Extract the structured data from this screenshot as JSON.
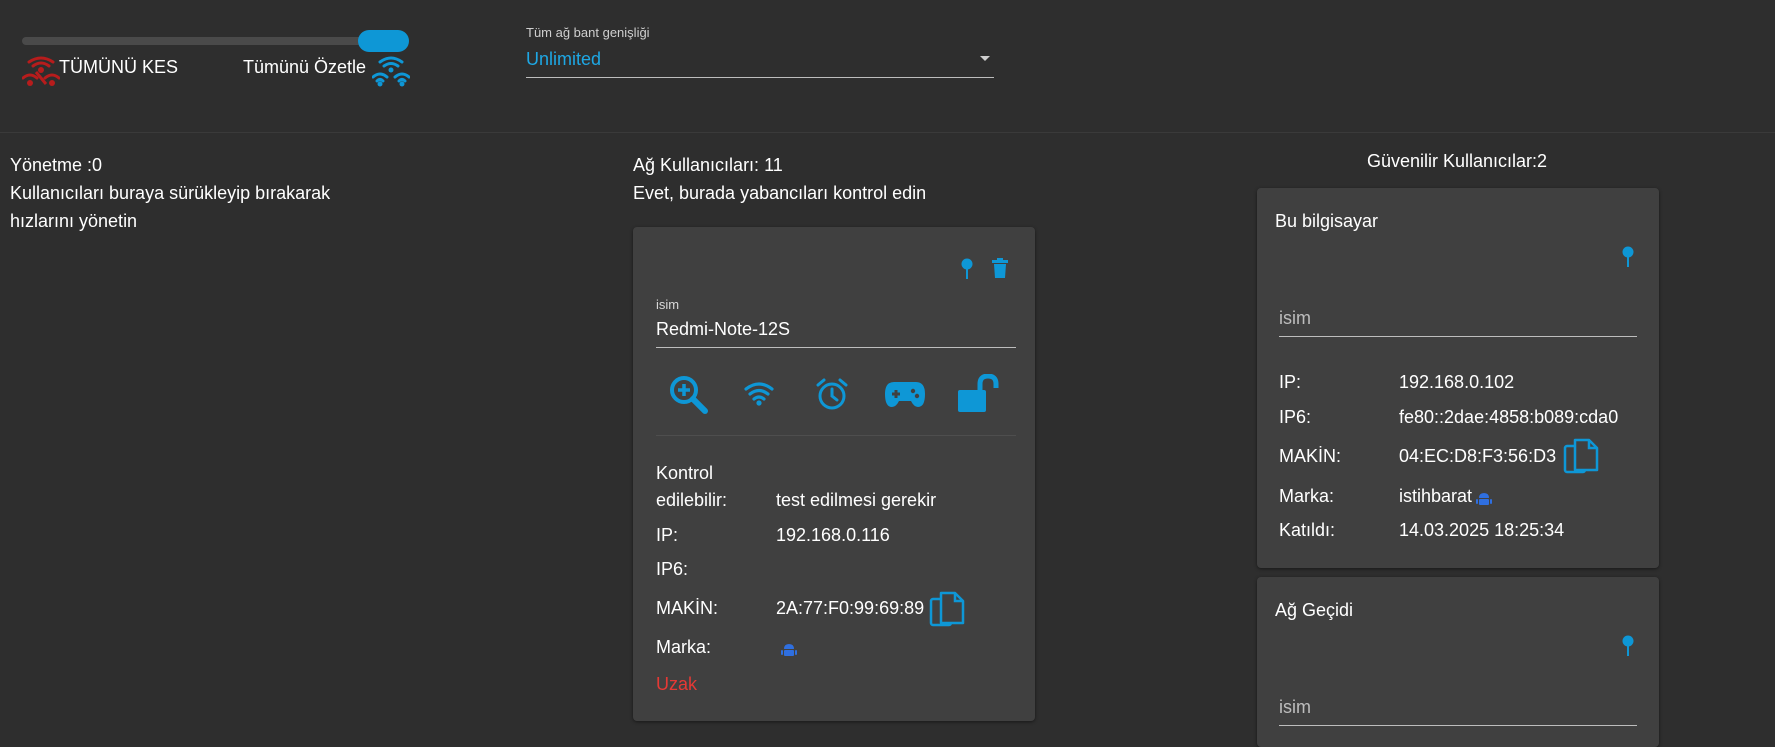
{
  "top": {
    "cut_all_label": "TÜMÜNÜ KES",
    "summarize_all_label": "Tümünü Özetle",
    "bandwidth_label": "Tüm ağ bant genişliği",
    "bandwidth_value": "Unlimited",
    "slider_level": 1.0
  },
  "managed": {
    "count_label": "Yönetme :0",
    "hint_line1": "Kullanıcıları buraya sürükleyip bırakarak",
    "hint_line2": "hızlarını yönetin"
  },
  "network": {
    "count_label": "Ağ Kullanıcıları: 11",
    "subtitle": "Evet, burada yabancıları kontrol edin",
    "card": {
      "name_label": "isim",
      "name_value": "Redmi-Note-12S",
      "controllable_label_1": "Kontrol",
      "controllable_label_2": "edilebilir:",
      "controllable_value": "test edilmesi gerekir",
      "ip_label": "IP:",
      "ip_value": "192.168.0.116",
      "ip6_label": "IP6:",
      "ip6_value": "",
      "mac_label": "MAKİN:",
      "mac_value": "2A:77:F0:99:69:89",
      "brand_label": "Marka:",
      "status": "Uzak"
    }
  },
  "trusted": {
    "count_label": "Güvenilir Kullanıcılar:2",
    "this_pc": {
      "title": "Bu bilgisayar",
      "name_placeholder": "isim",
      "ip_label": "IP:",
      "ip_value": "192.168.0.102",
      "ip6_label": "IP6:",
      "ip6_value": "fe80::2dae:4858:b089:cda0",
      "mac_label": "MAKİN:",
      "mac_value": "04:EC:D8:F3:56:D3",
      "brand_label": "Marka:",
      "brand_value": "istihbarat",
      "joined_label": "Katıldı:",
      "joined_value": "14.03.2025 18:25:34"
    },
    "gateway": {
      "title": "Ağ Geçidi",
      "name_placeholder": "isim"
    }
  },
  "colors": {
    "accent": "#0e97d6",
    "danger_icon": "#b71c1c",
    "status_far": "#e53935",
    "android": "#2f6fe0",
    "background": "#2e2e2e",
    "card": "#404040"
  }
}
